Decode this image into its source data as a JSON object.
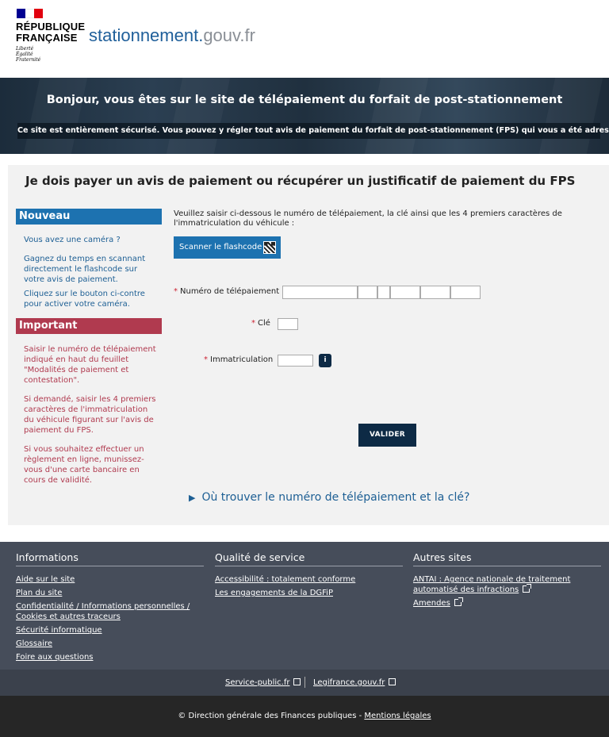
{
  "header": {
    "rf_title_line1": "RÉPUBLIQUE",
    "rf_title_line2": "FRANÇAISE",
    "motto_line1": "Liberté",
    "motto_line2": "Égalité",
    "motto_line3": "Fraternité",
    "site_name_main": "stationnement.",
    "site_name_gouv": "gouv.fr",
    "flag_colors": [
      "#000091",
      "#ffffff",
      "#e1000f"
    ]
  },
  "banner": {
    "title": "Bonjour, vous êtes sur le site de télépaiement du forfait de post-stationnement",
    "subtitle": "Ce site est entièrement sécurisé. Vous pouvez y régler tout avis de paiement du forfait de post-stationnement (FPS) qui vous a été adressé à domicile."
  },
  "main": {
    "title": "Je dois payer un avis de paiement ou récupérer un justificatif de paiement du FPS",
    "nouveau": {
      "heading": "Nouveau",
      "p1": "Vous avez une caméra ?",
      "p2": "Gagnez du temps en scannant directement le flashcode sur votre avis de paiement.",
      "p3": "Cliquez sur le bouton ci-contre pour activer votre caméra."
    },
    "important": {
      "heading": "Important",
      "p1": "Saisir le numéro de télépaiement indiqué en haut du feuillet \"Modalités de paiement et contestation\".",
      "p2": "Si demandé, saisir les 4 premiers caractères de l'immatriculation du véhicule figurant sur l'avis de paiement du FPS.",
      "p3": "Si vous souhaitez effectuer un règlement en ligne, munissez-vous d'une carte bancaire en cours de validité."
    },
    "instructions": "Veuillez saisir ci-dessous le numéro de télépaiement, la clé ainsi que les 4 premiers caractères de l'immatriculation du véhicule :",
    "scan_button": "Scanner le flashcode",
    "required_mark": "*",
    "label_numero": "Numéro de télépaiement",
    "label_cle": "Clé",
    "label_immat": "Immatriculation",
    "info_button": "i",
    "valider_button": "VALIDER",
    "find_link": "Où trouver le numéro de télépaiement et la clé?",
    "find_link_icon": "▶"
  },
  "footer": {
    "col1": {
      "heading": "Informations",
      "links": [
        "Aide sur le site",
        "Plan du site",
        "Confidentialité / Informations personnelles / Cookies et autres traceurs",
        "Sécurité informatique",
        "Glossaire",
        "Foire aux questions"
      ]
    },
    "col2": {
      "heading": "Qualité de service",
      "links": [
        "Accessibilité : totalement conforme",
        "Les engagements de la DGFiP"
      ]
    },
    "col3": {
      "heading": "Autres sites",
      "links": [
        "ANTAI : Agence nationale de traitement automatisé des infractions",
        "Amendes"
      ]
    },
    "bottom_links": [
      "Service-public.fr",
      "Legifrance.gouv.fr"
    ],
    "copyright": "© Direction générale des Finances publiques - ",
    "mentions": "Mentions légales"
  }
}
